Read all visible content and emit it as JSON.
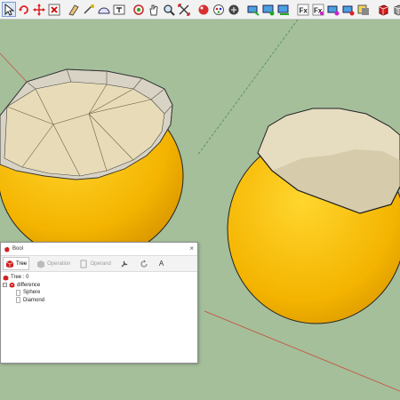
{
  "toolbar": {
    "icons": [
      "select-icon",
      "rotate-icon",
      "pan-icon",
      "x-icon",
      "eraser-icon",
      "tape-measure-icon",
      "protractor-icon",
      "text-icon",
      "orbit-icon",
      "hand-pan-icon",
      "zoom-icon",
      "zoom-extents-icon",
      "face-style-icon",
      "material-icon",
      "map-icon",
      "camera-icon",
      "scene-icon",
      "section-icon",
      "fx-icon",
      "fx-plus-icon",
      "component-icon",
      "tag-icon",
      "shadow-icon",
      "cube-red-icon",
      "cube-gray-icon"
    ],
    "active_tool": "select-icon"
  },
  "viewport": {
    "background_color": "#a4bf9a",
    "sphere_color": "#f4b400",
    "axes": [
      "red-axis",
      "green-axis"
    ]
  },
  "bool_panel": {
    "title": "Bool",
    "close": "×",
    "tabs": [
      {
        "label": "Tree",
        "enabled": true
      },
      {
        "label": "Operation",
        "enabled": false
      },
      {
        "label": "Operand",
        "enabled": false
      }
    ],
    "extra_icons": [
      "wrench-icon",
      "refresh-icon",
      "font-icon"
    ],
    "extra_font_label": "A",
    "tree": {
      "root": "Tree : 0",
      "node": "difference",
      "children": [
        "Sphere",
        "Diamond"
      ]
    }
  }
}
